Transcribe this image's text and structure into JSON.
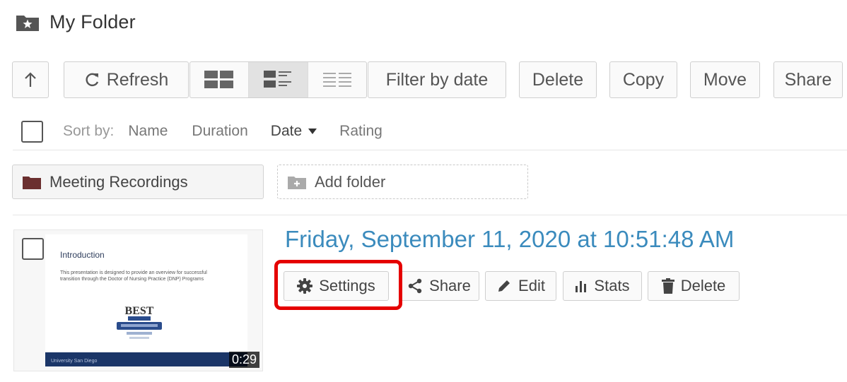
{
  "header": {
    "title": "My Folder"
  },
  "toolbar": {
    "up_icon": "arrow-up-icon",
    "refresh_label": "Refresh",
    "views": [
      "grid-view-icon",
      "details-view-icon",
      "list-view-icon"
    ],
    "filter_label": "Filter by date",
    "delete_label": "Delete",
    "copy_label": "Copy",
    "move_label": "Move",
    "share_label": "Share"
  },
  "sort": {
    "label": "Sort by:",
    "options": [
      "Name",
      "Duration",
      "Date",
      "Rating"
    ],
    "active": "Date"
  },
  "folders": {
    "item_label": "Meeting Recordings",
    "add_label": "Add folder"
  },
  "recording": {
    "date": "Friday, September 11, 2020 at 10:51:48 AM",
    "duration": "0:29",
    "thumbnail": {
      "title": "Introduction",
      "text": "This presentation is designed to provide an overview for successful transition through the Doctor of Nursing Practice (DNP) Programs",
      "badge_text": "BEST",
      "footer": "University San Diego"
    },
    "actions": {
      "settings": "Settings",
      "share": "Share",
      "edit": "Edit",
      "stats": "Stats",
      "delete": "Delete"
    }
  },
  "colors": {
    "link_blue": "#3b8bbd",
    "highlight_red": "#e50000",
    "slide_navy": "#1b3668",
    "folder_maroon": "#6b2f2f"
  }
}
